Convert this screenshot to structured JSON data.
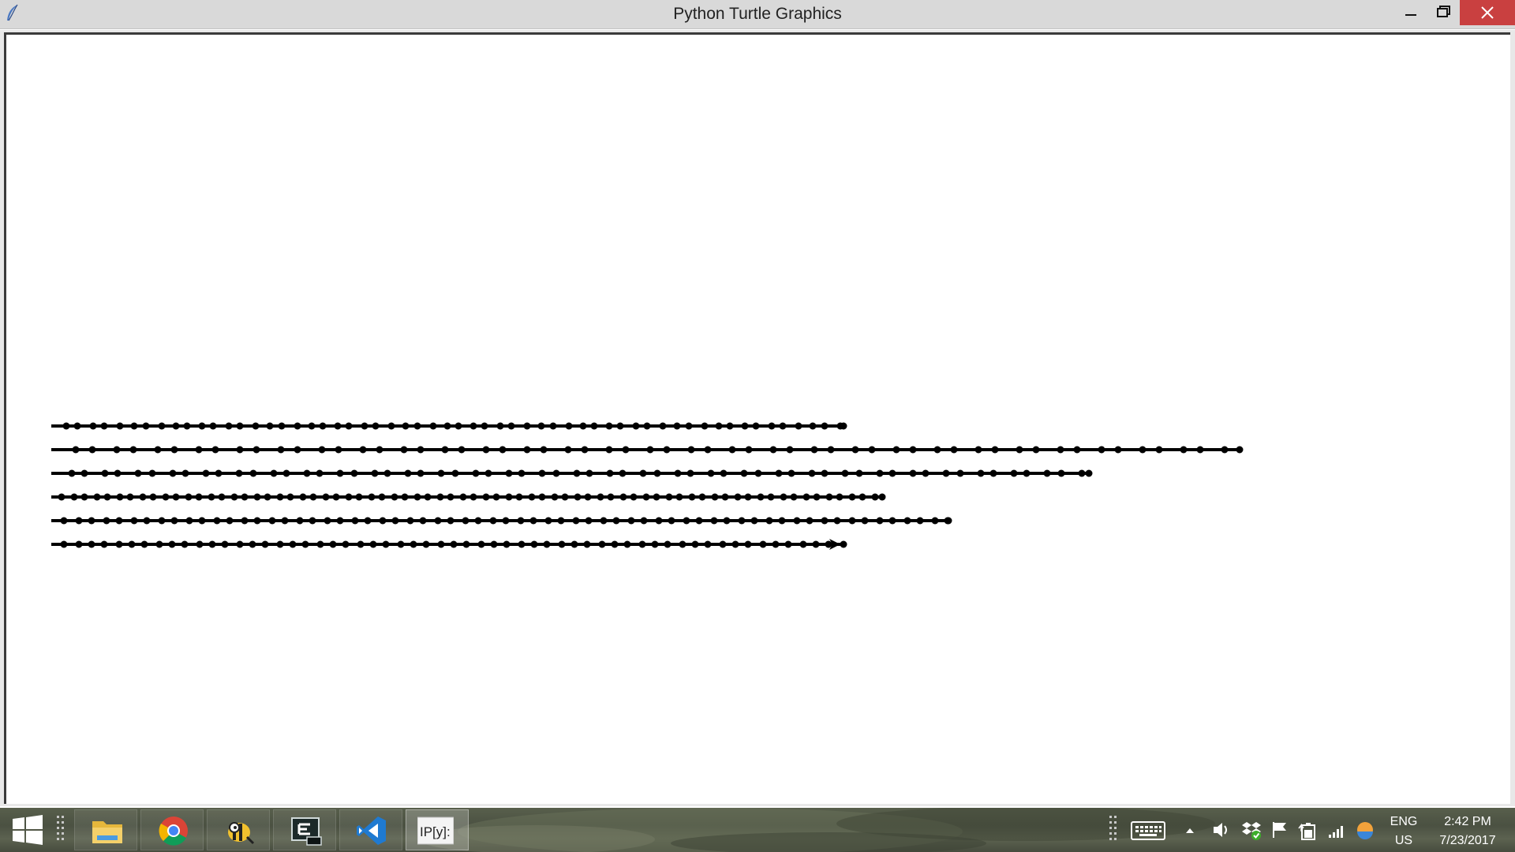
{
  "window": {
    "title": "Python Turtle Graphics",
    "app_icon": "feather-icon",
    "controls": [
      "minimize-icon",
      "restore-icon",
      "close-icon"
    ]
  },
  "canvas": {
    "background": "#ffffff",
    "pen_color": "#000000",
    "turtle_shape": "arrow-icon",
    "rows": [
      {
        "length": 1004,
        "gap_sequence": [
          19,
          14,
          20,
          14,
          20,
          18,
          15,
          20,
          18,
          14
        ]
      },
      {
        "length": 1506,
        "gap_sequence": [
          31,
          21
        ]
      },
      {
        "length": 1315,
        "gap_sequence": [
          26,
          16,
          26,
          16,
          26,
          18
        ]
      },
      {
        "length": 1053,
        "gap_sequence": [
          13,
          16,
          13,
          16,
          13,
          16
        ]
      },
      {
        "length": 1137,
        "gap_sequence": [
          16,
          19,
          16,
          19,
          16,
          19
        ]
      },
      {
        "length": 1004,
        "gap_sequence": [
          16,
          19,
          16,
          16,
          19,
          16
        ]
      }
    ]
  },
  "taskbar": {
    "start_icon": "windows-logo-icon",
    "apps": [
      {
        "name": "file-explorer-icon",
        "color": "#e6b73c"
      },
      {
        "name": "chrome-icon",
        "color": "#db4437"
      },
      {
        "name": "bee-app-icon",
        "color": "#f2c12e"
      },
      {
        "name": "terminal-icon",
        "color": "#1b8a8a"
      },
      {
        "name": "vscode-icon",
        "color": "#1f7ad1"
      },
      {
        "name": "ipython-icon",
        "color": "#e8e8e8",
        "label": "IP[y]:"
      }
    ],
    "tray_icons": [
      "touch-keyboard-icon",
      "show-hidden-icons-icon",
      "volume-icon",
      "dropbox-icon",
      "action-center-flag-icon",
      "battery-icon",
      "network-signal-icon",
      "weather-icon"
    ],
    "language_top": "ENG",
    "language_bottom": "US",
    "time": "2:42 PM",
    "date": "7/23/2017"
  }
}
